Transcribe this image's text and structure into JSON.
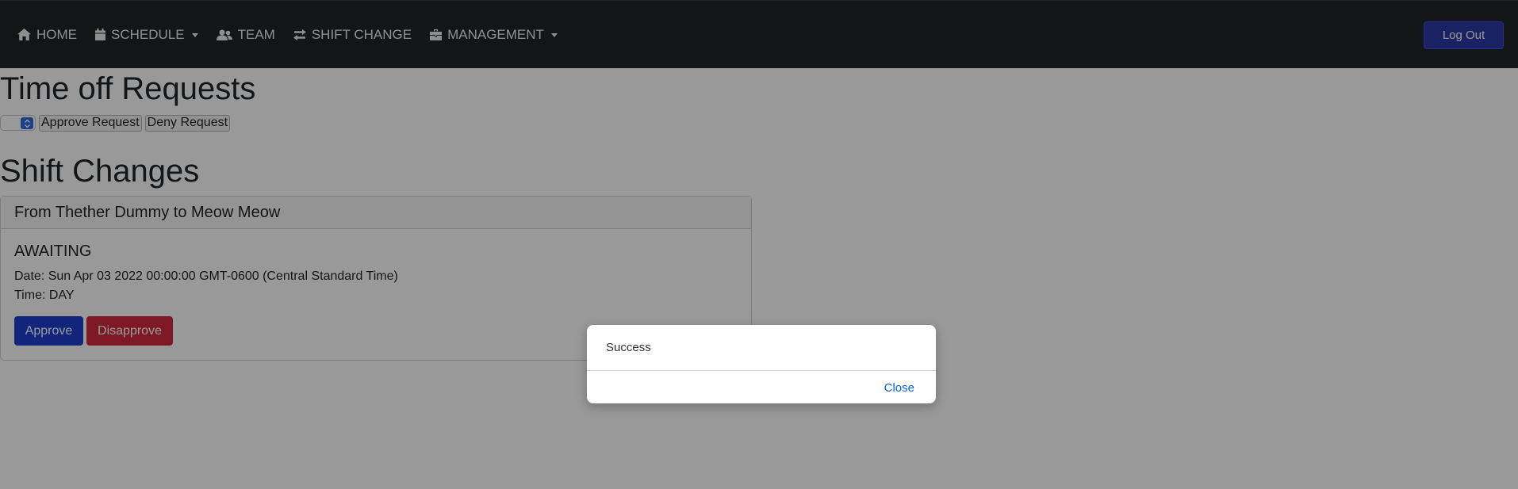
{
  "navbar": {
    "items": [
      {
        "label": "HOME",
        "icon": "home-icon"
      },
      {
        "label": "SCHEDULE",
        "icon": "calendar-icon",
        "dropdown": true
      },
      {
        "label": "TEAM",
        "icon": "users-icon"
      },
      {
        "label": "SHIFT CHANGE",
        "icon": "exchange-icon"
      },
      {
        "label": "MANAGEMENT",
        "icon": "briefcase-icon",
        "dropdown": true
      }
    ],
    "logout_label": "Log Out"
  },
  "time_off": {
    "title": "Time off Requests",
    "approve_label": "Approve Request",
    "deny_label": "Deny Request"
  },
  "shift_changes": {
    "title": "Shift Changes",
    "card": {
      "header": "From Thether Dummy to Meow Meow",
      "status": "AWAITING",
      "date": "Date: Sun Apr 03 2022 00:00:00 GMT-0600 (Central Standard Time)",
      "time": "Time: DAY",
      "approve_label": "Approve",
      "disapprove_label": "Disapprove"
    }
  },
  "modal": {
    "message": "Success",
    "close_label": "Close"
  },
  "colors": {
    "navbar_bg": "#212529",
    "primary": "#1d3fcf",
    "danger": "#d12a3f",
    "link": "#0a64d6"
  }
}
